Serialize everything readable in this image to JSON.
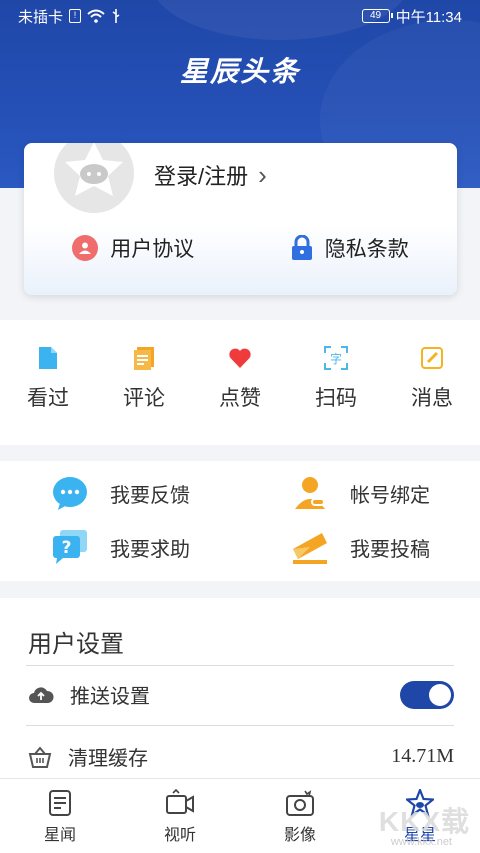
{
  "status_bar": {
    "carrier": "未插卡",
    "battery": "49",
    "time": "中午11:34"
  },
  "app": {
    "logo": "星辰头条"
  },
  "login_card": {
    "login_label": "登录/注册",
    "user_agreement": "用户协议",
    "privacy_policy": "隐私条款"
  },
  "quick_actions": [
    {
      "label": "看过",
      "icon": "document-icon",
      "color": "#3bb3f0"
    },
    {
      "label": "评论",
      "icon": "comment-doc-icon",
      "color": "#f5a524"
    },
    {
      "label": "点赞",
      "icon": "heart-icon",
      "color": "#ef3b3b"
    },
    {
      "label": "扫码",
      "icon": "scan-icon",
      "color": "#4fb6e8"
    },
    {
      "label": "消息",
      "icon": "message-edit-icon",
      "color": "#f5b324"
    }
  ],
  "services": [
    {
      "label": "我要反馈",
      "icon": "feedback-bubble-icon"
    },
    {
      "label": "帐号绑定",
      "icon": "account-bind-icon"
    },
    {
      "label": "我要求助",
      "icon": "help-icon"
    },
    {
      "label": "我要投稿",
      "icon": "submit-envelope-icon"
    }
  ],
  "settings": {
    "title": "用户设置",
    "push": {
      "label": "推送设置",
      "enabled": true
    },
    "cache": {
      "label": "清理缓存",
      "value": "14.71M"
    }
  },
  "bottom_nav": [
    {
      "label": "星闻",
      "icon": "news-icon",
      "active": false
    },
    {
      "label": "视听",
      "icon": "video-icon",
      "active": false
    },
    {
      "label": "影像",
      "icon": "camera-icon",
      "active": false
    },
    {
      "label": "星星",
      "icon": "star-icon",
      "active": true
    }
  ],
  "watermark": {
    "main": "KKX载",
    "sub": "www.kkx.net"
  },
  "colors": {
    "brand": "#1f47a8",
    "background": "#f2f4f7"
  }
}
